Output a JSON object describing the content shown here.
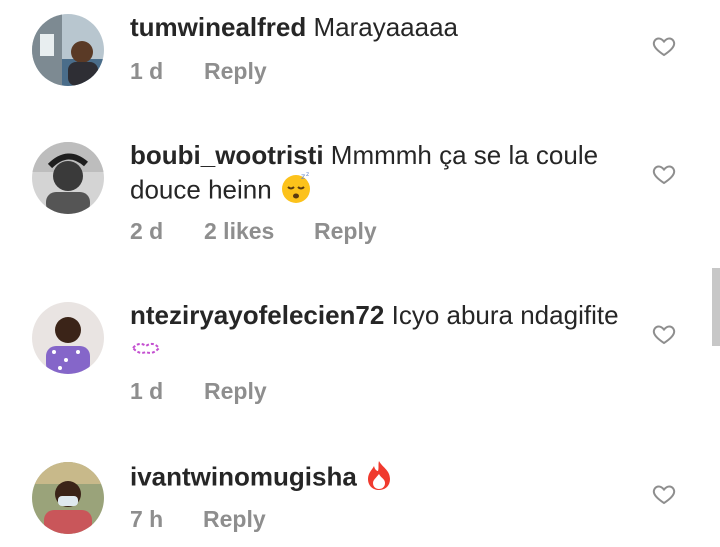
{
  "comments": [
    {
      "username": "tumwinealfred",
      "text": "Marayaaaaa",
      "time": "1 d",
      "likes": "",
      "reply": "Reply",
      "emoji": ""
    },
    {
      "username": "boubi_wootristi",
      "text": "Mmmmh ça se la coule douce heinn",
      "time": "2 d",
      "likes": "2 likes",
      "reply": "Reply",
      "emoji": "sleeping-face-emoji"
    },
    {
      "username": "nteziryayofelecien72",
      "text": "Icyo abura ndagifite",
      "time": "1 d",
      "likes": "",
      "reply": "Reply",
      "emoji": "kiss-lips-emoji"
    },
    {
      "username": "ivantwinomugisha",
      "text": "",
      "time": "7 h",
      "likes": "",
      "reply": "Reply",
      "emoji": "fire-emoji"
    }
  ],
  "icons": {
    "like": "heart-outline-icon"
  },
  "colors": {
    "text": "#262626",
    "meta": "#8e8e8e",
    "heart_stroke": "#8e8e8e"
  }
}
